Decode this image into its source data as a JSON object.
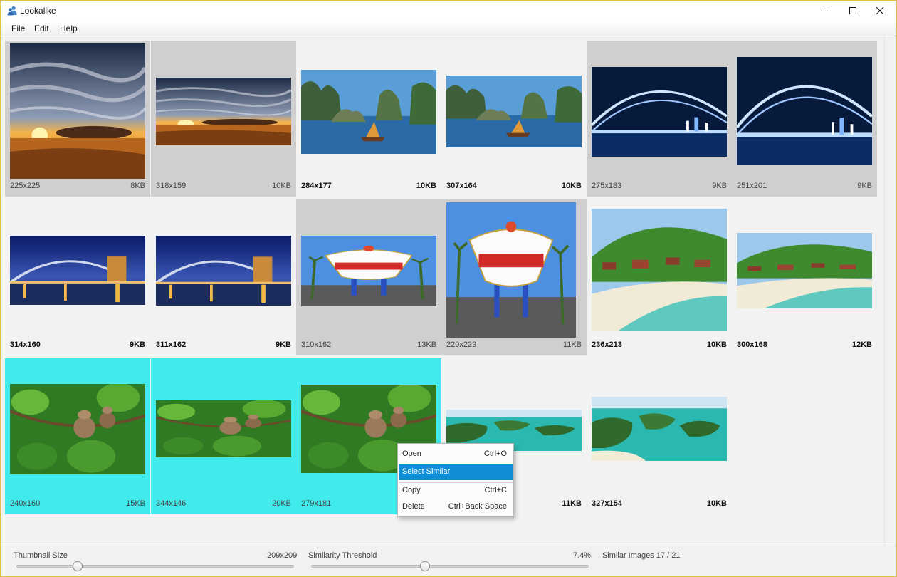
{
  "window": {
    "title": "Lookalike"
  },
  "menu": {
    "items": [
      "File",
      "Edit",
      "Help"
    ]
  },
  "icons": {
    "app": "people-icon",
    "minimize": "minimize-icon",
    "maximize": "maximize-icon",
    "close": "close-icon"
  },
  "colors": {
    "selection_grey": "#cfcfcf",
    "selection_cyan": "#42ebeb",
    "menu_highlight": "#0f8ed6",
    "window_border": "#e5c04b"
  },
  "gallery": {
    "images": [
      {
        "dims": "225x225",
        "size": "8KB",
        "subject": "sunset",
        "selected": "grey"
      },
      {
        "dims": "318x159",
        "size": "10KB",
        "subject": "sunset",
        "selected": "grey"
      },
      {
        "dims": "284x177",
        "size": "10KB",
        "subject": "halong",
        "selected": "none"
      },
      {
        "dims": "307x164",
        "size": "10KB",
        "subject": "halong",
        "selected": "none"
      },
      {
        "dims": "275x183",
        "size": "9KB",
        "subject": "bridge-blue",
        "selected": "grey"
      },
      {
        "dims": "251x201",
        "size": "9KB",
        "subject": "bridge-blue",
        "selected": "grey"
      },
      {
        "dims": "314x160",
        "size": "9KB",
        "subject": "bridge-night",
        "selected": "none"
      },
      {
        "dims": "311x162",
        "size": "9KB",
        "subject": "bridge-night",
        "selected": "none"
      },
      {
        "dims": "310x162",
        "size": "13KB",
        "subject": "vegas",
        "selected": "grey"
      },
      {
        "dims": "220x229",
        "size": "11KB",
        "subject": "vegas",
        "selected": "grey"
      },
      {
        "dims": "236x213",
        "size": "10KB",
        "subject": "beach",
        "selected": "none"
      },
      {
        "dims": "300x168",
        "size": "12KB",
        "subject": "beach",
        "selected": "none"
      },
      {
        "dims": "240x160",
        "size": "15KB",
        "subject": "monkey",
        "selected": "cyan"
      },
      {
        "dims": "344x146",
        "size": "20KB",
        "subject": "monkey",
        "selected": "cyan"
      },
      {
        "dims": "279x181",
        "size": "",
        "subject": "monkey",
        "selected": "cyan"
      },
      {
        "dims": "",
        "size": "11KB",
        "subject": "islands",
        "selected": "none"
      },
      {
        "dims": "327x154",
        "size": "10KB",
        "subject": "islands",
        "selected": "none"
      }
    ]
  },
  "context_menu": {
    "items": [
      {
        "label": "Open",
        "shortcut": "Ctrl+O",
        "active": false
      },
      {
        "label": "Select Similar",
        "shortcut": "",
        "active": true
      },
      {
        "label": "Copy",
        "shortcut": "Ctrl+C",
        "active": false
      },
      {
        "label": "Delete",
        "shortcut": "Ctrl+Back Space",
        "active": false
      }
    ]
  },
  "status": {
    "thumbnail_size_label": "Thumbnail Size",
    "thumbnail_size_value": "209x209",
    "thumbnail_slider_fraction": 0.22,
    "similarity_label": "Similarity Threshold",
    "similarity_value": "7.4%",
    "similarity_slider_fraction": 0.41,
    "similar_images": "Similar Images 17 / 21"
  }
}
